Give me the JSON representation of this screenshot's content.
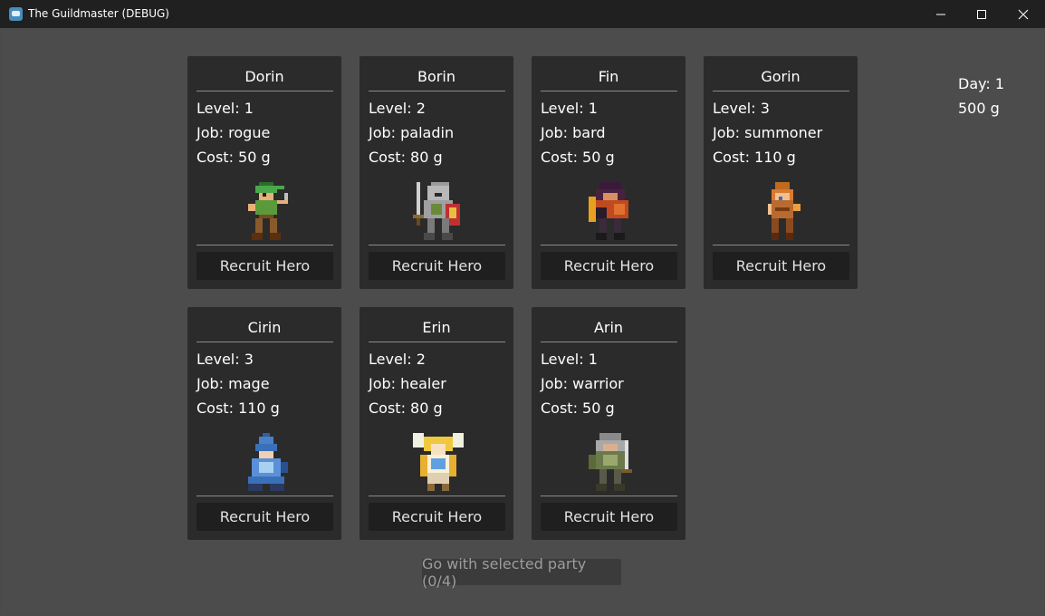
{
  "window": {
    "title": "The Guildmaster (DEBUG)",
    "icon": "godot-icon",
    "controls": [
      "minimize-icon",
      "maximize-icon",
      "close-icon"
    ]
  },
  "stats": {
    "day": "Day: 1",
    "gold": "500 g"
  },
  "heroes": [
    {
      "name": "Dorin",
      "level": "Level: 1",
      "job": "Job: rogue",
      "cost": "Cost: 50 g",
      "sprite": "rogue-sprite-icon",
      "button": "Recruit Hero"
    },
    {
      "name": "Borin",
      "level": "Level: 2",
      "job": "Job: paladin",
      "cost": "Cost: 80 g",
      "sprite": "paladin-sprite-icon",
      "button": "Recruit Hero"
    },
    {
      "name": "Fin",
      "level": "Level: 1",
      "job": "Job: bard",
      "cost": "Cost: 50 g",
      "sprite": "bard-sprite-icon",
      "button": "Recruit Hero"
    },
    {
      "name": "Gorin",
      "level": "Level: 3",
      "job": "Job: summoner",
      "cost": "Cost: 110 g",
      "sprite": "summoner-sprite-icon",
      "button": "Recruit Hero"
    },
    {
      "name": "Cirin",
      "level": "Level: 3",
      "job": "Job: mage",
      "cost": "Cost: 110 g",
      "sprite": "mage-sprite-icon",
      "button": "Recruit Hero"
    },
    {
      "name": "Erin",
      "level": "Level: 2",
      "job": "Job: healer",
      "cost": "Cost: 80 g",
      "sprite": "healer-sprite-icon",
      "button": "Recruit Hero"
    },
    {
      "name": "Arin",
      "level": "Level: 1",
      "job": "Job: warrior",
      "cost": "Cost: 50 g",
      "sprite": "warrior-sprite-icon",
      "button": "Recruit Hero"
    }
  ],
  "go_button": "Go with selected party (0/4)",
  "colors": {
    "background": "#4c4c4c",
    "card": "#2b2b2b",
    "button": "#1f1f1f",
    "titlebar": "#202020"
  }
}
